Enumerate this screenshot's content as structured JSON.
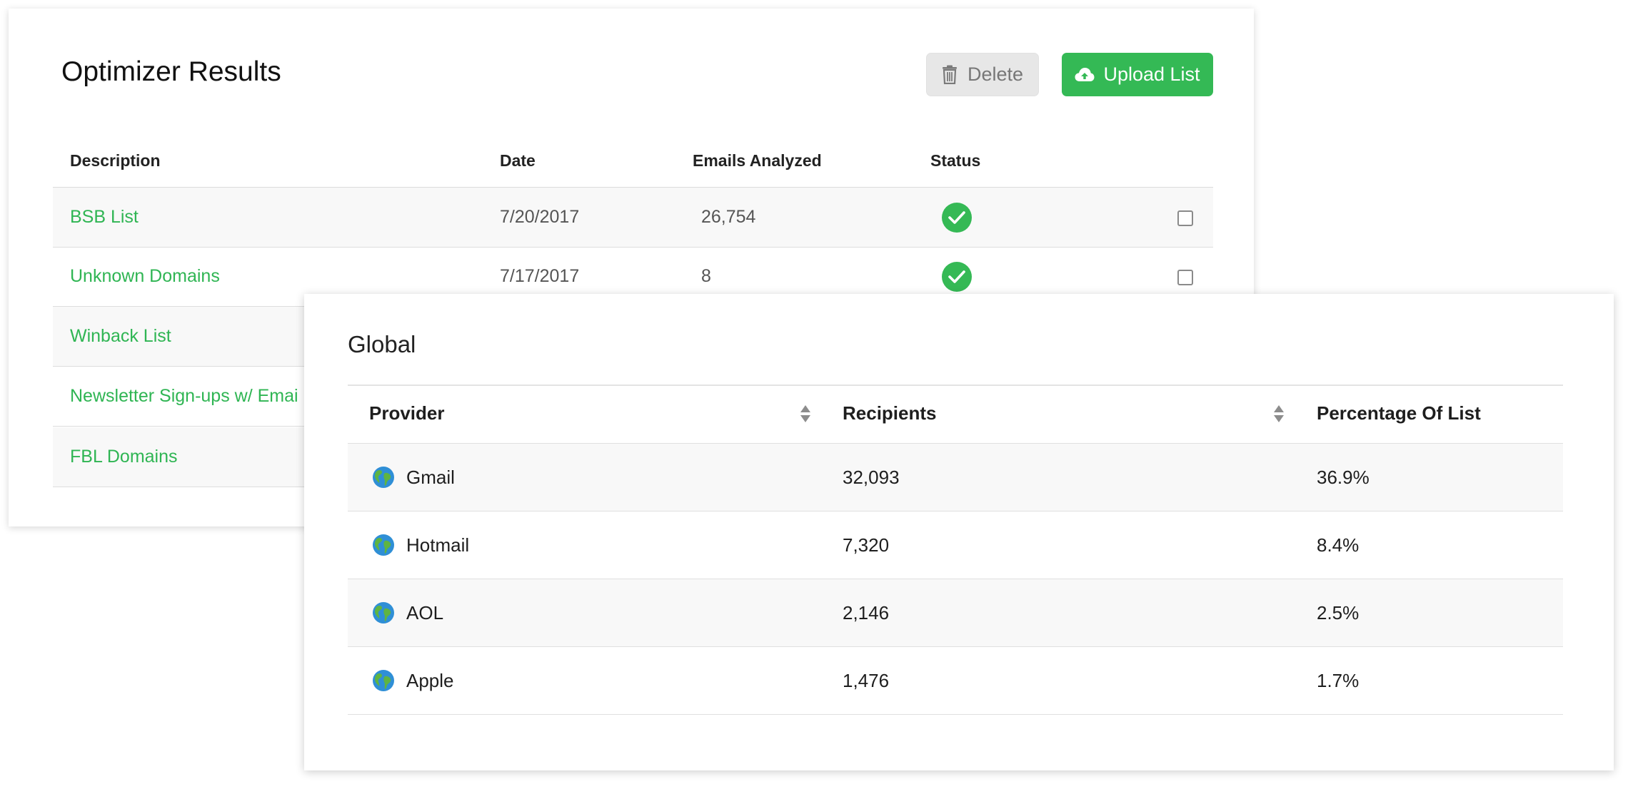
{
  "optimizer": {
    "title": "Optimizer Results",
    "delete_label": "Delete",
    "upload_label": "Upload List",
    "columns": {
      "description": "Description",
      "date": "Date",
      "emails": "Emails Analyzed",
      "status": "Status"
    },
    "rows": [
      {
        "description": "BSB List",
        "date": "7/20/2017",
        "emails": "26,754",
        "status": "check-icon"
      },
      {
        "description": "Unknown Domains",
        "date": "7/17/2017",
        "emails": "8",
        "status": "check-icon"
      },
      {
        "description": "Winback List"
      },
      {
        "description": "Newsletter Sign-ups w/ Emai"
      },
      {
        "description": "FBL Domains"
      }
    ]
  },
  "global": {
    "title": "Global",
    "columns": {
      "provider": "Provider",
      "recipients": "Recipients",
      "percentage": "Percentage Of List"
    },
    "rows": [
      {
        "provider": "Gmail",
        "recipients": "32,093",
        "percentage": "36.9%",
        "icon": "globe-icon"
      },
      {
        "provider": "Hotmail",
        "recipients": "7,320",
        "percentage": "8.4%",
        "icon": "globe-icon"
      },
      {
        "provider": "AOL",
        "recipients": "2,146",
        "percentage": "2.5%",
        "icon": "globe-icon"
      },
      {
        "provider": "Apple",
        "recipients": "1,476",
        "percentage": "1.7%",
        "icon": "globe-icon"
      }
    ]
  },
  "colors": {
    "accent_green": "#34b955",
    "link_green": "#2fb553",
    "delete_bg": "#e7e7e7"
  }
}
